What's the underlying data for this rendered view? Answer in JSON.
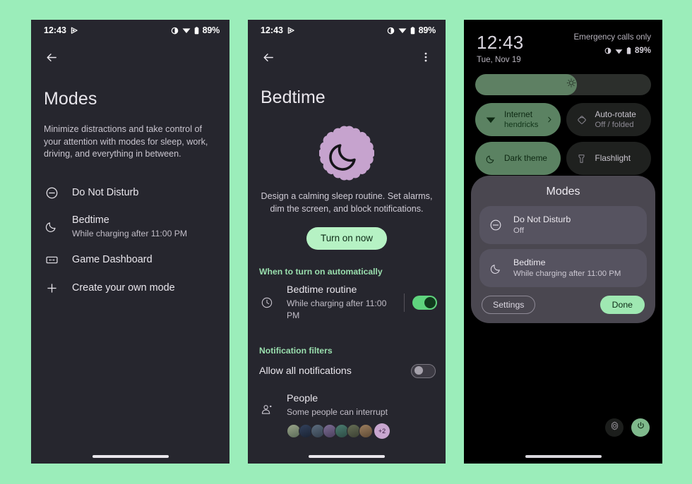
{
  "background_color": "#9BEDBA",
  "phone1": {
    "status_bar": {
      "time": "12:43",
      "battery": "89%",
      "icons": [
        "cast-icon",
        "contrast-icon",
        "wifi-icon",
        "battery-icon"
      ]
    },
    "back_icon": "arrow-back-icon",
    "title": "Modes",
    "description": "Minimize distractions and take control of your attention with modes for sleep, work, driving, and everything in between.",
    "modes": [
      {
        "icon": "do-not-disturb-icon",
        "title": "Do Not Disturb",
        "subtitle": ""
      },
      {
        "icon": "moon-icon",
        "title": "Bedtime",
        "subtitle": "While charging after 11:00 PM"
      },
      {
        "icon": "game-dashboard-icon",
        "title": "Game Dashboard",
        "subtitle": ""
      },
      {
        "icon": "plus-icon",
        "title": "Create your own mode",
        "subtitle": ""
      }
    ]
  },
  "phone2": {
    "status_bar": {
      "time": "12:43",
      "battery": "89%"
    },
    "back_icon": "arrow-back-icon",
    "overflow_icon": "more-vert-icon",
    "title": "Bedtime",
    "badge_icon": "moon-icon",
    "badge_color": "#C6A3CE",
    "description": "Design a calming sleep routine. Set alarms, dim the screen, and block notifications.",
    "cta_label": "Turn on now",
    "cta_color": "#B6F2C4",
    "section_auto": "When to turn on automatically",
    "auto_row": {
      "icon": "clock-icon",
      "title": "Bedtime routine",
      "subtitle": "While charging after 11:00 PM",
      "toggle_state": "on"
    },
    "section_filters": "Notification filters",
    "allow_row": {
      "label": "Allow all notifications",
      "toggle_state": "off"
    },
    "people_row": {
      "icon": "people-icon",
      "title": "People",
      "subtitle": "Some people can interrupt",
      "avatar_count": 7,
      "avatar_colors": [
        "#7E8B6E",
        "#2D3B54",
        "#4B5A6B",
        "#6B5E86",
        "#3F6E63",
        "#57604A",
        "#8A6F53"
      ],
      "more_badge": "+2"
    }
  },
  "phone3": {
    "clock": "12:43",
    "date": "Tue, Nov 19",
    "carrier": "Emergency calls only",
    "battery": "89%",
    "brightness_icon": "brightness-icon",
    "tiles": [
      {
        "icon": "wifi-icon",
        "label": "Internet",
        "sublabel": "hendricks",
        "state": "on",
        "chevron": "chevron-right-icon"
      },
      {
        "icon": "auto-rotate-icon",
        "label": "Auto-rotate",
        "sublabel": "Off / folded",
        "state": "off",
        "chevron": ""
      },
      {
        "icon": "dark-theme-icon",
        "label": "Dark theme",
        "sublabel": "",
        "state": "on",
        "chevron": ""
      },
      {
        "icon": "flashlight-icon",
        "label": "Flashlight",
        "sublabel": "",
        "state": "off",
        "chevron": ""
      }
    ],
    "dialog": {
      "title": "Modes",
      "items": [
        {
          "icon": "do-not-disturb-icon",
          "title": "Do Not Disturb",
          "subtitle": "Off"
        },
        {
          "icon": "moon-icon",
          "title": "Bedtime",
          "subtitle": "While charging after 11:00 PM"
        }
      ],
      "settings_label": "Settings",
      "done_label": "Done",
      "done_color": "#9FE8B2"
    },
    "bottom_buttons": [
      {
        "icon": "gear-icon",
        "name": "settings-button"
      },
      {
        "icon": "power-icon",
        "name": "power-button"
      }
    ]
  }
}
